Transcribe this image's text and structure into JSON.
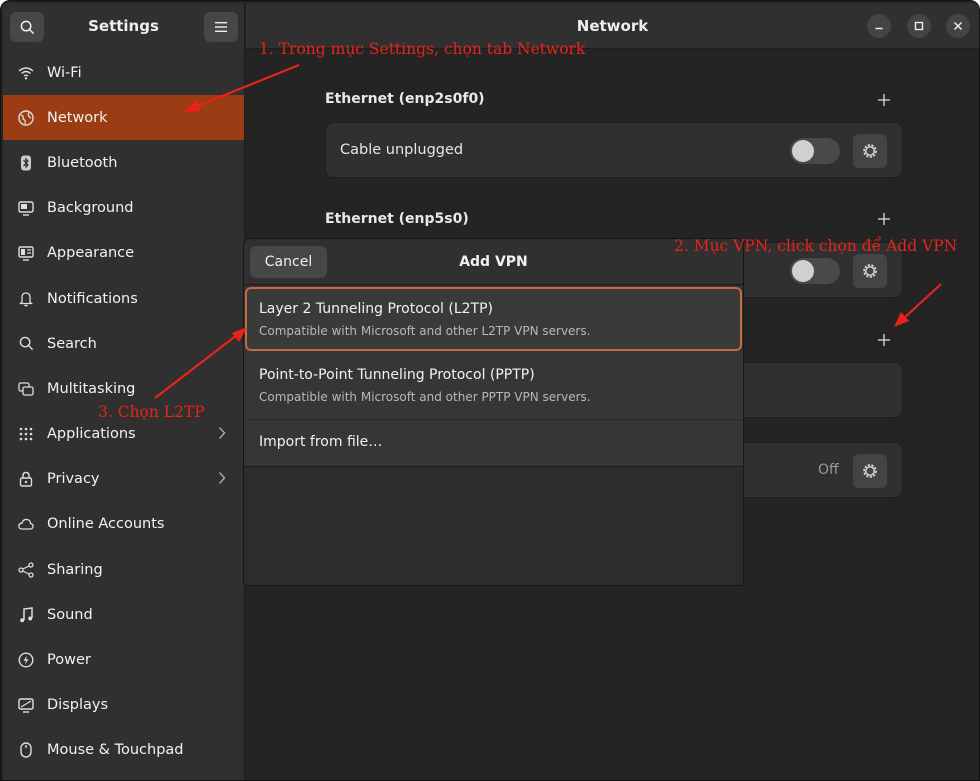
{
  "sidebar": {
    "title": "Settings",
    "items": [
      {
        "label": "Wi-Fi",
        "icon": "wifi-icon"
      },
      {
        "label": "Network",
        "icon": "globe-icon",
        "active": true
      },
      {
        "label": "Bluetooth",
        "icon": "bluetooth-icon"
      },
      {
        "label": "Background",
        "icon": "monitor-icon"
      },
      {
        "label": "Appearance",
        "icon": "appearance-icon"
      },
      {
        "label": "Notifications",
        "icon": "bell-icon"
      },
      {
        "label": "Search",
        "icon": "search-icon"
      },
      {
        "label": "Multitasking",
        "icon": "multitasking-icon"
      },
      {
        "label": "Applications",
        "icon": "grid-icon",
        "chevron": true
      },
      {
        "label": "Privacy",
        "icon": "lock-icon",
        "chevron": true
      },
      {
        "label": "Online Accounts",
        "icon": "cloud-icon"
      },
      {
        "label": "Sharing",
        "icon": "share-icon"
      },
      {
        "label": "Sound",
        "icon": "music-icon"
      },
      {
        "label": "Power",
        "icon": "power-icon"
      },
      {
        "label": "Displays",
        "icon": "display-icon"
      },
      {
        "label": "Mouse & Touchpad",
        "icon": "mouse-icon"
      }
    ]
  },
  "header": {
    "title": "Network"
  },
  "sections": {
    "eth1": {
      "title": "Ethernet (enp2s0f0)",
      "status": "Cable unplugged"
    },
    "eth2": {
      "title": "Ethernet (enp5s0)"
    },
    "proxy": {
      "status": "Off"
    }
  },
  "dialog": {
    "cancel_label": "Cancel",
    "title": "Add VPN",
    "options": [
      {
        "title": "Layer 2 Tunneling Protocol (L2TP)",
        "subtitle": "Compatible with Microsoft and other L2TP VPN servers."
      },
      {
        "title": "Point-to-Point Tunneling Protocol (PPTP)",
        "subtitle": "Compatible with Microsoft and other PPTP VPN servers."
      },
      {
        "title": "Import from file…"
      }
    ]
  },
  "annotations": {
    "step1": "1. Trong mục Settings, chọn tab Network",
    "step2": "2. Mục VPN, click chọn để Add VPN",
    "step3": "3. Chọn L2TP"
  },
  "colors": {
    "accent": "#9b3c14",
    "selection_border": "#c46a3e",
    "annotation": "#e8231a"
  }
}
